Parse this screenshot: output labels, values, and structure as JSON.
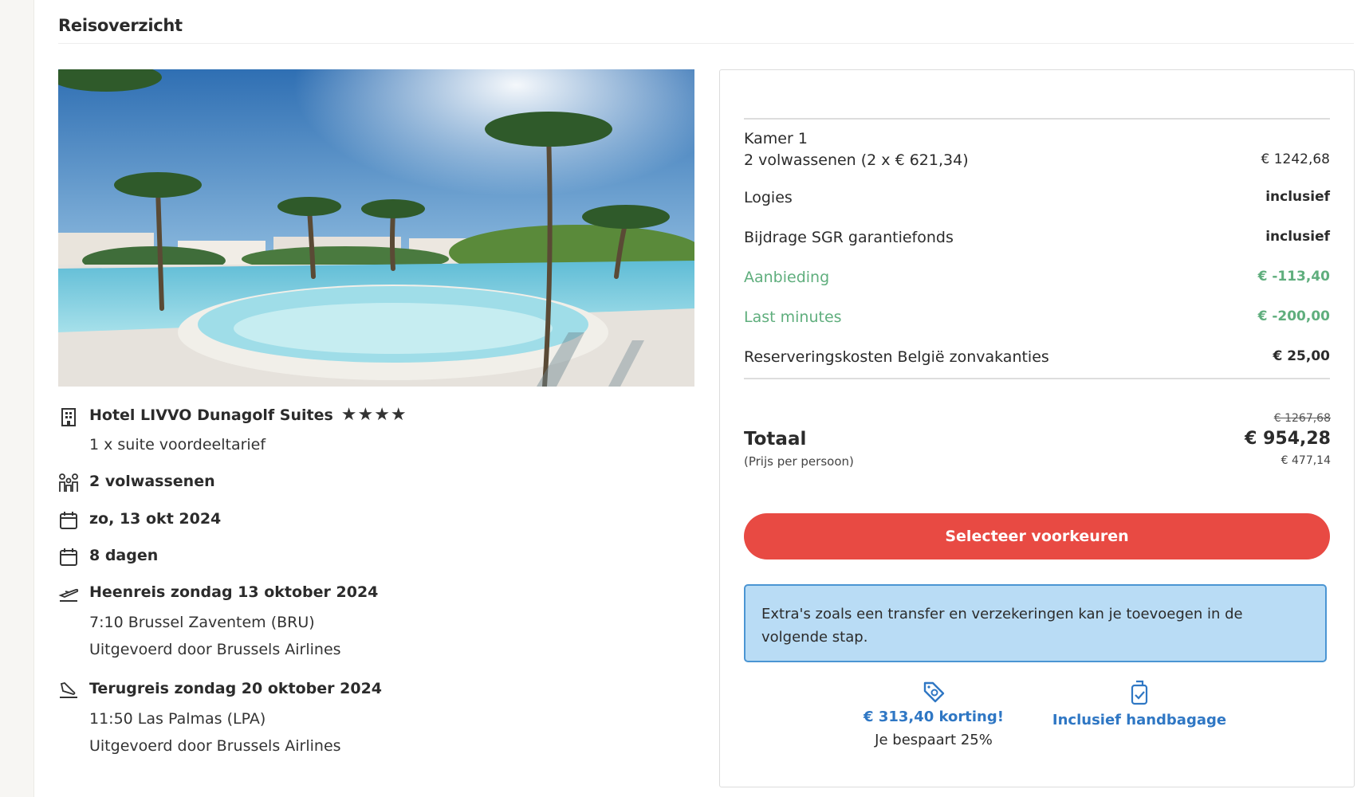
{
  "page": {
    "title": "Reisoverzicht"
  },
  "hotel": {
    "name": "Hotel LIVVO Dunagolf Suites",
    "stars": "★★★★",
    "room": "1 x suite voordeeltarief",
    "photo_icon": "hotel-pool-photo"
  },
  "details": {
    "travellers": "2 volwassenen",
    "date": "zo, 13 okt 2024",
    "duration": "8 dagen",
    "outbound": {
      "title": "Heenreis zondag 13 oktober 2024",
      "time_airport": "7:10 Brussel Zaventem (BRU)",
      "operator": "Uitgevoerd door Brussels Airlines"
    },
    "return": {
      "title": "Terugreis zondag 20 oktober 2024",
      "time_airport": "11:50 Las Palmas (LPA)",
      "operator": "Uitgevoerd door Brussels Airlines"
    }
  },
  "summary": {
    "room_label": "Kamer 1",
    "room_line": "2 volwassenen (2 x € 621,34)",
    "room_price": "€ 1242,68",
    "lines": [
      {
        "label": "Logies",
        "value": "inclusief"
      },
      {
        "label": "Bijdrage SGR garantiefonds",
        "value": "inclusief"
      },
      {
        "label": "Aanbieding",
        "value": "€ -113,40"
      },
      {
        "label": "Last minutes",
        "value": "€ -200,00"
      },
      {
        "label": "Reserveringskosten België zonvakanties",
        "value": "€ 25,00"
      }
    ],
    "total_label": "Totaal",
    "per_person_label": "(Prijs per persoon)",
    "old_price": "€ 1267,68",
    "total_price": "€ 954,28",
    "per_person_price": "€ 477,14",
    "cta_label": "Selecteer voorkeuren",
    "info_text": "Extra's zoals een transfer en verzekeringen kan je toevoegen in de volgende stap.",
    "usp_discount": "€ 313,40 korting!",
    "usp_discount_sub": "Je bespaart 25%",
    "usp_baggage": "Inclusief handbagage"
  },
  "colors": {
    "accent_red": "#e84a43",
    "discount_green": "#5fae7d",
    "link_blue": "#2f77c4",
    "info_bg": "#b9dcf5",
    "info_border": "#4b95d3"
  }
}
